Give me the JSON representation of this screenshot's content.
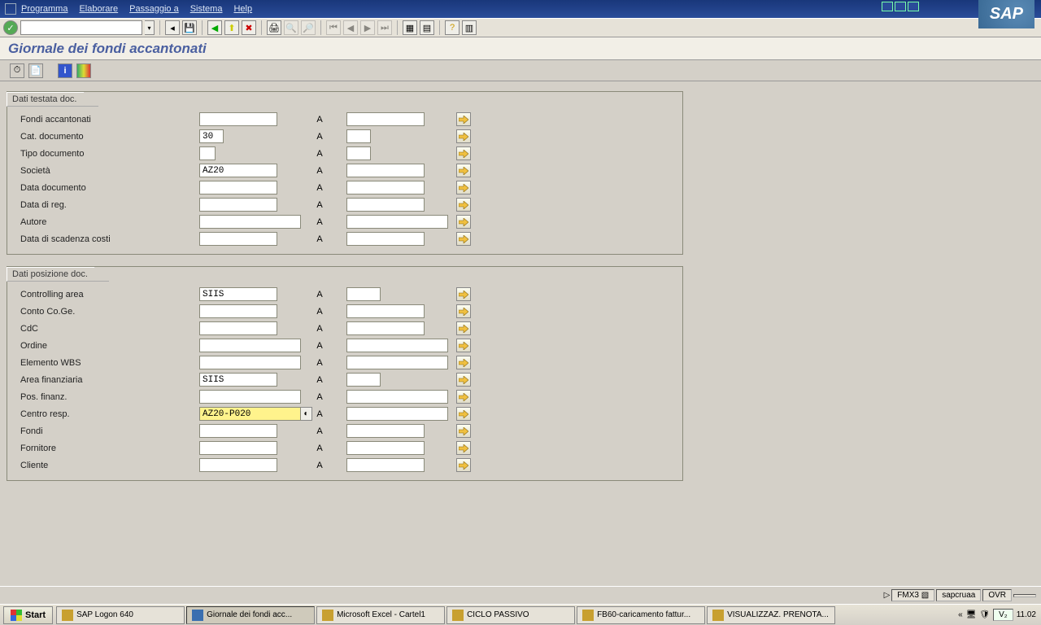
{
  "menu": [
    "Programma",
    "Elaborare",
    "Passaggio a",
    "Sistema",
    "Help"
  ],
  "page_title": "Giornale dei fondi accantonati",
  "group1_title": "Dati testata doc.",
  "group2_title": "Dati posizione doc.",
  "a": "A",
  "g1": {
    "fondi_accantonati": {
      "label": "Fondi accantonati",
      "v1": "",
      "v2": ""
    },
    "cat_documento": {
      "label": "Cat. documento",
      "v1": "30",
      "v2": ""
    },
    "tipo_documento": {
      "label": "Tipo documento",
      "v1": "",
      "v2": ""
    },
    "societa": {
      "label": "Società",
      "v1": "AZ20",
      "v2": ""
    },
    "data_documento": {
      "label": "Data documento",
      "v1": "",
      "v2": ""
    },
    "data_di_reg": {
      "label": "Data di reg.",
      "v1": "",
      "v2": ""
    },
    "autore": {
      "label": "Autore",
      "v1": "",
      "v2": ""
    },
    "data_scadenza": {
      "label": "Data di scadenza costi",
      "v1": "",
      "v2": ""
    }
  },
  "g2": {
    "controlling_area": {
      "label": "Controlling area",
      "v1": "SIIS",
      "v2": ""
    },
    "conto_coge": {
      "label": "Conto Co.Ge.",
      "v1": "",
      "v2": ""
    },
    "cdc": {
      "label": "CdC",
      "v1": "",
      "v2": ""
    },
    "ordine": {
      "label": "Ordine",
      "v1": "",
      "v2": ""
    },
    "elemento_wbs": {
      "label": "Elemento WBS",
      "v1": "",
      "v2": ""
    },
    "area_finanziaria": {
      "label": "Area finanziaria",
      "v1": "SIIS",
      "v2": ""
    },
    "pos_finanz": {
      "label": "Pos. finanz.",
      "v1": "",
      "v2": ""
    },
    "centro_resp": {
      "label": "Centro resp.",
      "v1": "AZ20-P020",
      "v2": ""
    },
    "fondi": {
      "label": "Fondi",
      "v1": "",
      "v2": ""
    },
    "fornitore": {
      "label": "Fornitore",
      "v1": "",
      "v2": ""
    },
    "cliente": {
      "label": "Cliente",
      "v1": "",
      "v2": ""
    }
  },
  "status": {
    "sys": "FMX3",
    "srv": "sapcruaa",
    "ins": "OVR"
  },
  "taskbar": {
    "start": "Start",
    "items": [
      {
        "label": "SAP Logon 640"
      },
      {
        "label": "Giornale dei fondi acc...",
        "active": true
      },
      {
        "label": "Microsoft Excel - Cartel1"
      },
      {
        "label": "CICLO PASSIVO"
      },
      {
        "label": "FB60-caricamento fattur..."
      },
      {
        "label": "VISUALIZZAZ. PRENOTA..."
      }
    ],
    "clock": "11.02"
  }
}
